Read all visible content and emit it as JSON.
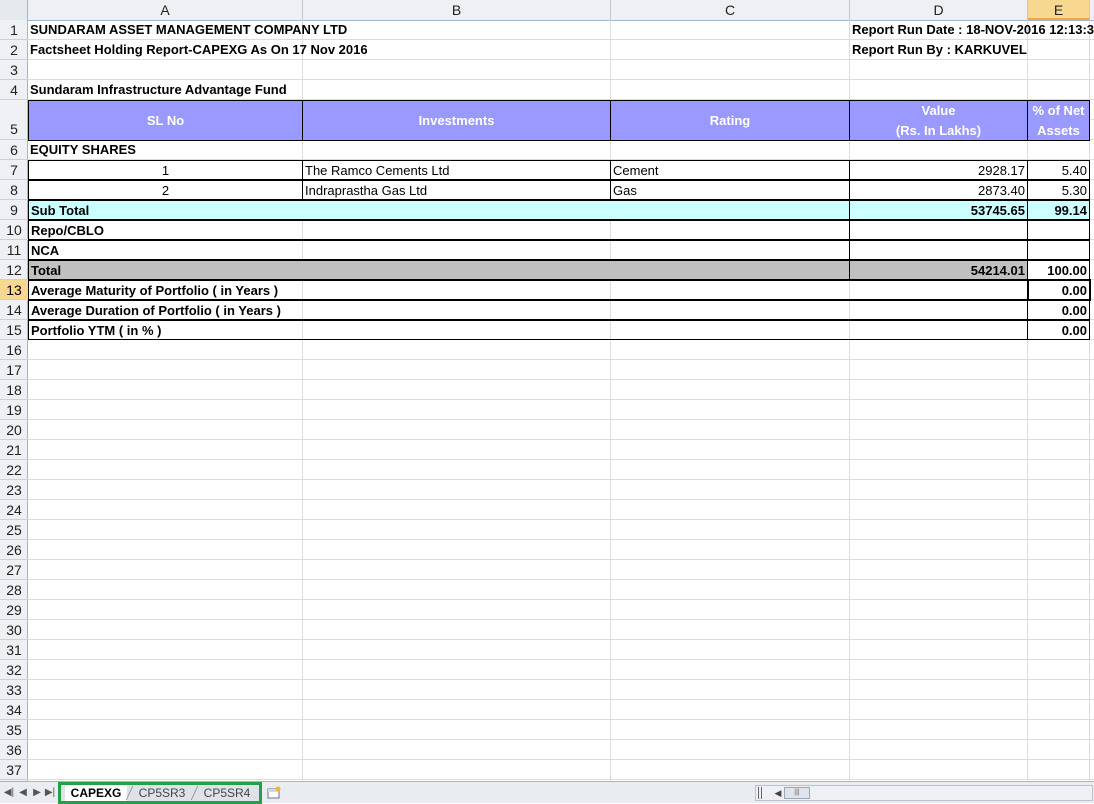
{
  "columns": [
    "A",
    "B",
    "C",
    "D",
    "E"
  ],
  "active_column": "E",
  "rows": [
    "1",
    "2",
    "3",
    "4",
    "5",
    "6",
    "7",
    "8",
    "9",
    "10",
    "11",
    "12",
    "13",
    "14",
    "15",
    "16",
    "17",
    "18",
    "19",
    "20",
    "21",
    "22",
    "23",
    "24",
    "25",
    "26",
    "27",
    "28",
    "29",
    "30",
    "31",
    "32",
    "33",
    "34",
    "35",
    "36",
    "37"
  ],
  "active_row": "13",
  "sheet": {
    "company": "SUNDARAM ASSET MANAGEMENT COMPANY LTD",
    "report_title": "Factsheet Holding Report-CAPEXG As On 17 Nov 2016",
    "run_date": "Report Run Date : 18-NOV-2016 12:13:3",
    "run_by": "Report Run By : KARKUVEL",
    "fund_name": "Sundaram Infrastructure Advantage Fund",
    "headers": {
      "sl_no": "SL No",
      "investments": "Investments",
      "rating": "Rating",
      "value_line1": "Value",
      "value_line2": "(Rs. In Lakhs)",
      "pct_line1": "% of Net",
      "pct_line2": "Assets"
    },
    "section_equity": "EQUITY SHARES",
    "holdings": [
      {
        "sl": "1",
        "name": "The Ramco Cements Ltd",
        "rating": "Cement",
        "value": "2928.17",
        "pct": "5.40"
      },
      {
        "sl": "2",
        "name": "Indraprastha Gas Ltd",
        "rating": "Gas",
        "value": "2873.40",
        "pct": "5.30"
      }
    ],
    "subtotal": {
      "label": "Sub Total",
      "value": "53745.65",
      "pct": "99.14"
    },
    "repo_label": "Repo/CBLO",
    "nca_label": "NCA",
    "total": {
      "label": "Total",
      "value": "54214.01",
      "pct": "100.00"
    },
    "avg_maturity": {
      "label": "Average Maturity of Portfolio ( in Years )",
      "value": "0.00"
    },
    "avg_duration": {
      "label": "Average Duration of Portfolio ( in Years )",
      "value": "0.00"
    },
    "ytm": {
      "label": "Portfolio YTM ( in % )",
      "value": "0.00"
    }
  },
  "tabs": [
    "CAPEXG",
    "CP5SR3",
    "CP5SR4"
  ],
  "active_tab": "CAPEXG",
  "scroll_thumb_glyph": "|||",
  "colors": {
    "header_fill": "#9999ff",
    "subtotal_fill": "#ccffff",
    "total_fill": "#c0c0c0",
    "tab_highlight": "#22a045"
  },
  "icons": {
    "first_sheet": "first-sheet-icon",
    "prev_sheet": "prev-sheet-icon",
    "next_sheet": "next-sheet-icon",
    "last_sheet": "last-sheet-icon",
    "new_sheet": "new-sheet-icon"
  }
}
